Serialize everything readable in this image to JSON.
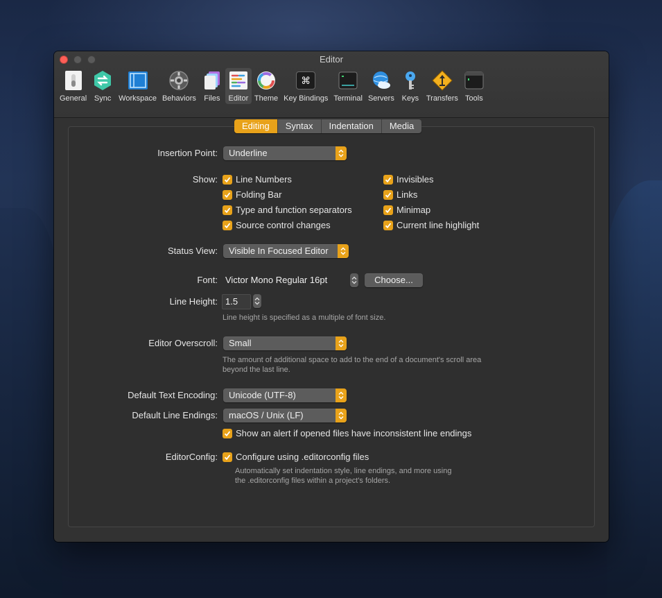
{
  "window": {
    "title": "Editor"
  },
  "toolbar": {
    "items": [
      {
        "label": "General",
        "icon": "switch-icon"
      },
      {
        "label": "Sync",
        "icon": "sync-icon"
      },
      {
        "label": "Workspace",
        "icon": "workspace-icon"
      },
      {
        "label": "Behaviors",
        "icon": "behaviors-icon"
      },
      {
        "label": "Files",
        "icon": "files-icon"
      },
      {
        "label": "Editor",
        "icon": "editor-icon"
      },
      {
        "label": "Theme",
        "icon": "theme-icon"
      },
      {
        "label": "Key Bindings",
        "icon": "command-key-icon"
      },
      {
        "label": "Terminal",
        "icon": "terminal-icon"
      },
      {
        "label": "Servers",
        "icon": "servers-icon"
      },
      {
        "label": "Keys",
        "icon": "key-icon"
      },
      {
        "label": "Transfers",
        "icon": "transfers-icon"
      },
      {
        "label": "Tools",
        "icon": "tools-icon"
      }
    ],
    "active": "Editor",
    "command_symbol": "⌘"
  },
  "tabs": [
    "Editing",
    "Syntax",
    "Indentation",
    "Media"
  ],
  "active_tab": "Editing",
  "insertion_point": {
    "label": "Insertion Point:",
    "value": "Underline"
  },
  "show": {
    "label": "Show:",
    "left": [
      {
        "label": "Line Numbers",
        "checked": true
      },
      {
        "label": "Folding Bar",
        "checked": true
      },
      {
        "label": "Type and function separators",
        "checked": true
      },
      {
        "label": "Source control changes",
        "checked": true
      }
    ],
    "right": [
      {
        "label": "Invisibles",
        "checked": true
      },
      {
        "label": "Links",
        "checked": true
      },
      {
        "label": "Minimap",
        "checked": true
      },
      {
        "label": "Current line highlight",
        "checked": true
      }
    ]
  },
  "status_view": {
    "label": "Status View:",
    "value": "Visible In Focused Editor"
  },
  "font": {
    "label": "Font:",
    "value": "Victor Mono Regular 16pt",
    "choose_label": "Choose..."
  },
  "line_height": {
    "label": "Line Height:",
    "value": "1.5",
    "note": "Line height is specified as a multiple of font size."
  },
  "overscroll": {
    "label": "Editor Overscroll:",
    "value": "Small",
    "note_line1": "The amount of additional space to add to the end of a document's scroll area",
    "note_line2": "beyond the last line."
  },
  "encoding": {
    "label": "Default Text Encoding:",
    "value": "Unicode (UTF-8)"
  },
  "line_endings": {
    "label": "Default Line Endings:",
    "value": "macOS / Unix (LF)",
    "alert_label": "Show an alert if opened files have inconsistent line endings",
    "alert_checked": true
  },
  "editorconfig": {
    "label": "EditorConfig:",
    "checkbox_label": "Configure using .editorconfig files",
    "checked": true,
    "note_line1": "Automatically set indentation style, line endings, and more using",
    "note_line2": "the .editorconfig files within a project's folders."
  },
  "colors": {
    "accent": "#e8a21a",
    "window_bg": "#323232",
    "panel_bg": "#2f2f2f"
  }
}
